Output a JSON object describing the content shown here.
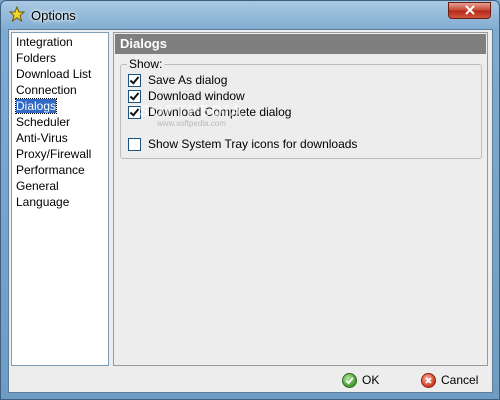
{
  "window": {
    "title": "Options",
    "icon": "star-icon",
    "close_icon": "close-icon"
  },
  "nav": {
    "items": [
      {
        "label": "Integration",
        "selected": false
      },
      {
        "label": "Folders",
        "selected": false
      },
      {
        "label": "Download List",
        "selected": false
      },
      {
        "label": "Connection",
        "selected": false
      },
      {
        "label": "Dialogs",
        "selected": true
      },
      {
        "label": "Scheduler",
        "selected": false
      },
      {
        "label": "Anti-Virus",
        "selected": false
      },
      {
        "label": "Proxy/Firewall",
        "selected": false
      },
      {
        "label": "Performance",
        "selected": false
      },
      {
        "label": "General",
        "selected": false
      },
      {
        "label": "Language",
        "selected": false
      }
    ]
  },
  "panel": {
    "header": "Dialogs",
    "group_label": "Show:",
    "options": [
      {
        "label": "Save As dialog",
        "checked": true
      },
      {
        "label": "Download window",
        "checked": true
      },
      {
        "label": "Download Complete dialog",
        "checked": true
      },
      {
        "label": "Show System Tray icons for downloads",
        "checked": false
      }
    ]
  },
  "footer": {
    "ok_label": "OK",
    "cancel_label": "Cancel",
    "ok_icon": "check-circle-icon",
    "cancel_icon": "x-circle-icon"
  },
  "watermark": {
    "text": "SOFTPEDIA",
    "sub": "www.softpedia.com"
  },
  "colors": {
    "selection": "#316ac5",
    "header_bg": "#7f7f7f",
    "close_button": "#c6432f"
  }
}
